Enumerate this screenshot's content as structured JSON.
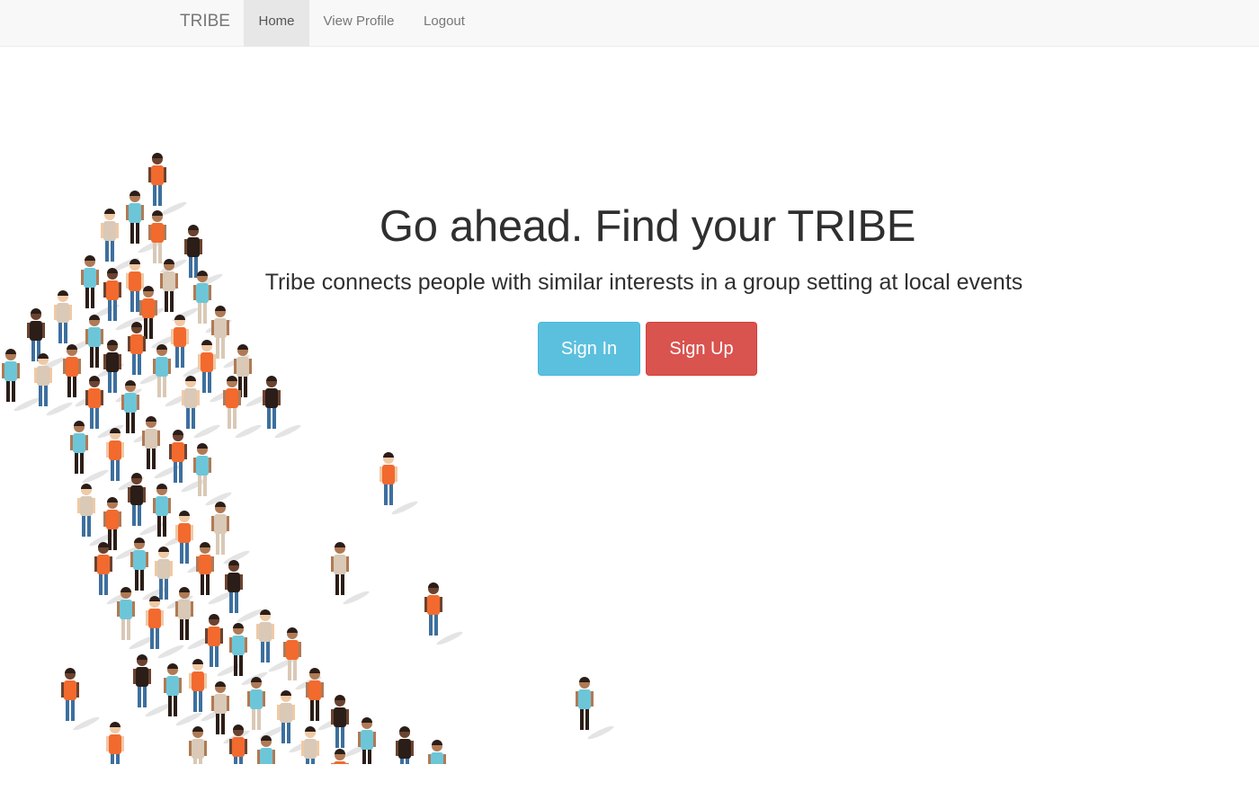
{
  "nav": {
    "brand": "TRIBE",
    "items": [
      {
        "label": "Home",
        "active": true
      },
      {
        "label": "View Profile",
        "active": false
      },
      {
        "label": "Logout",
        "active": false
      }
    ]
  },
  "hero": {
    "title": "Go ahead. Find your TRIBE",
    "subtitle": "Tribe connects people with similar interests in a group setting at local events",
    "buttons": {
      "sign_in": "Sign In",
      "sign_up": "Sign Up"
    }
  },
  "illustration": {
    "icon": "crowd-of-people-illustration",
    "colors": {
      "orange": "#f26a2e",
      "cyan": "#6cc6d8",
      "blue": "#3d6f9e",
      "dark": "#2b1d17",
      "beige": "#d9c9b6",
      "skin_dark": "#6b4330",
      "skin_mid": "#b07a55",
      "skin_light": "#f0c9a5"
    }
  },
  "theme": {
    "navbar_bg": "#f8f8f8",
    "info_button": "#5bc0de",
    "danger_button": "#d9534f",
    "text": "#2f2f2f"
  }
}
